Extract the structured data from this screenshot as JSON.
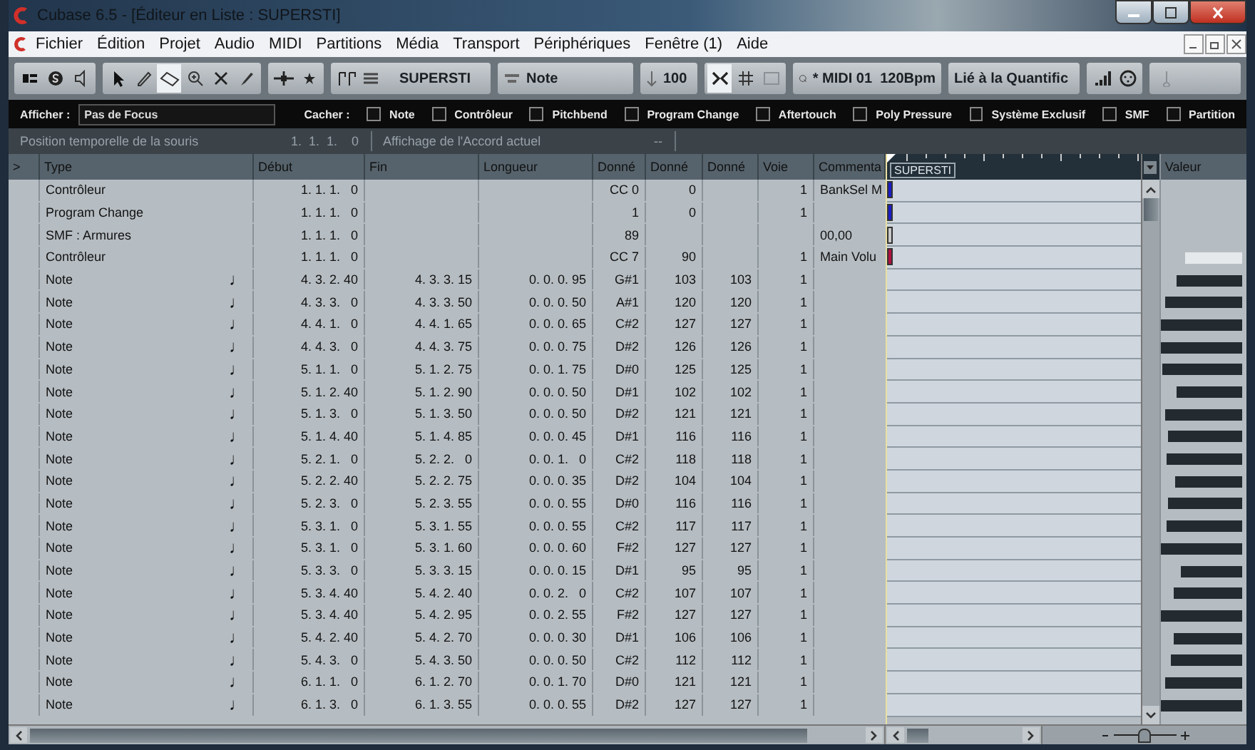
{
  "window": {
    "title": "Cubase 6.5 - [Éditeur en Liste : SUPERSTI]"
  },
  "menu": [
    "Fichier",
    "Édition",
    "Projet",
    "Audio",
    "MIDI",
    "Partitions",
    "Média",
    "Transport",
    "Périphériques",
    "Fenêtre (1)",
    "Aide"
  ],
  "toolbar": {
    "tools": [
      {
        "kind": "pointer",
        "selected": false
      },
      {
        "kind": "pencil",
        "selected": false
      },
      {
        "kind": "eraser",
        "selected": true
      },
      {
        "kind": "zoom",
        "selected": false
      },
      {
        "kind": "mute",
        "selected": false
      },
      {
        "kind": "brush",
        "selected": false
      }
    ],
    "track": "SUPERSTI",
    "insert_type": "Note",
    "velocity": "100",
    "quantize": "* MIDI 01  120Bpm",
    "length": "Lié à la Quantific"
  },
  "filter": {
    "show_label": "Afficher :",
    "show_value": "Pas de Focus",
    "hide_label": "Cacher :",
    "hide_options": [
      {
        "label": "Note",
        "checked": false
      },
      {
        "label": "Contrôleur",
        "checked": false
      },
      {
        "label": "Pitchbend",
        "checked": false
      },
      {
        "label": "Program Change",
        "checked": false
      },
      {
        "label": "Aftertouch",
        "checked": false
      },
      {
        "label": "Poly Pressure",
        "checked": false
      },
      {
        "label": "Système Exclusif",
        "checked": false
      },
      {
        "label": "SMF",
        "checked": false
      },
      {
        "label": "Partition",
        "checked": false
      }
    ]
  },
  "info": {
    "mouse_label": "Position temporelle de la souris",
    "mouse_value": "1.  1.  1.    0",
    "chord_label": "Affichage de l'Accord actuel",
    "chord_value": "--"
  },
  "table": {
    "columns": [
      ">",
      "Type",
      "Début",
      "Fin",
      "Longueur",
      "Donné",
      "Donné",
      "Donné",
      "Voie",
      "Commenta"
    ],
    "lane_label": "SUPERSTI",
    "value_column": "Valeur",
    "zoom": {
      "level": 0.5
    },
    "rows": [
      {
        "kind": "controller",
        "type": "Contrôleur",
        "start": "1. 1. 1.   0",
        "data1": "CC 0",
        "data2": "0",
        "channel": "1",
        "comment": "BankSel M",
        "color": "#1c1cc8"
      },
      {
        "kind": "program",
        "type": "Program Change",
        "start": "1. 1. 1.   0",
        "data1": "1",
        "data2": "0",
        "channel": "1",
        "color": "#1c1cc8"
      },
      {
        "kind": "meta",
        "type": "SMF : Armures",
        "start": "1. 1. 1.   0",
        "data1": "89",
        "comment": "00,00",
        "color": "#c8c8c8"
      },
      {
        "kind": "controller",
        "type": "Contrôleur",
        "start": "1. 1. 1.   0",
        "data1": "CC 7",
        "data2": "90",
        "channel": "1",
        "comment": "Main Volu",
        "color": "#b01040"
      },
      {
        "kind": "note",
        "type": "Note",
        "symbol": "♩",
        "start": "4. 3. 2. 40",
        "end": "4. 3. 3. 15",
        "length": "0. 0. 0. 95",
        "data1": "G#1",
        "data2": "103",
        "data3": "103",
        "channel": "1"
      },
      {
        "kind": "note",
        "type": "Note",
        "symbol": "♩",
        "start": "4. 3. 3.   0",
        "end": "4. 3. 3. 50",
        "length": "0. 0. 0. 50",
        "data1": "A#1",
        "data2": "120",
        "data3": "120",
        "channel": "1"
      },
      {
        "kind": "note",
        "type": "Note",
        "symbol": "♩",
        "start": "4. 4. 1.   0",
        "end": "4. 4. 1. 65",
        "length": "0. 0. 0. 65",
        "data1": "C#2",
        "data2": "127",
        "data3": "127",
        "channel": "1"
      },
      {
        "kind": "note",
        "type": "Note",
        "symbol": "♩",
        "start": "4. 4. 3.   0",
        "end": "4. 4. 3. 75",
        "length": "0. 0. 0. 75",
        "data1": "D#2",
        "data2": "126",
        "data3": "126",
        "channel": "1"
      },
      {
        "kind": "note",
        "type": "Note",
        "symbol": "♩",
        "start": "5. 1. 1.   0",
        "end": "5. 1. 2. 75",
        "length": "0. 0. 1. 75",
        "data1": "D#0",
        "data2": "125",
        "data3": "125",
        "channel": "1"
      },
      {
        "kind": "note",
        "type": "Note",
        "symbol": "♩",
        "start": "5. 1. 2. 40",
        "end": "5. 1. 2. 90",
        "length": "0. 0. 0. 50",
        "data1": "D#1",
        "data2": "102",
        "data3": "102",
        "channel": "1"
      },
      {
        "kind": "note",
        "type": "Note",
        "symbol": "♩",
        "start": "5. 1. 3.   0",
        "end": "5. 1. 3. 50",
        "length": "0. 0. 0. 50",
        "data1": "D#2",
        "data2": "121",
        "data3": "121",
        "channel": "1"
      },
      {
        "kind": "note",
        "type": "Note",
        "symbol": "♩",
        "start": "5. 1. 4. 40",
        "end": "5. 1. 4. 85",
        "length": "0. 0. 0. 45",
        "data1": "D#1",
        "data2": "116",
        "data3": "116",
        "channel": "1"
      },
      {
        "kind": "note",
        "type": "Note",
        "symbol": "♩",
        "start": "5. 2. 1.   0",
        "end": "5. 2. 2.   0",
        "length": "0. 0. 1.   0",
        "data1": "C#2",
        "data2": "118",
        "data3": "118",
        "channel": "1"
      },
      {
        "kind": "note",
        "type": "Note",
        "symbol": "♩",
        "start": "5. 2. 2. 40",
        "end": "5. 2. 2. 75",
        "length": "0. 0. 0. 35",
        "data1": "D#2",
        "data2": "104",
        "data3": "104",
        "channel": "1"
      },
      {
        "kind": "note",
        "type": "Note",
        "symbol": "♩",
        "start": "5. 2. 3.   0",
        "end": "5. 2. 3. 55",
        "length": "0. 0. 0. 55",
        "data1": "D#0",
        "data2": "116",
        "data3": "116",
        "channel": "1"
      },
      {
        "kind": "note",
        "type": "Note",
        "symbol": "♩",
        "start": "5. 3. 1.   0",
        "end": "5. 3. 1. 55",
        "length": "0. 0. 0. 55",
        "data1": "C#2",
        "data2": "117",
        "data3": "117",
        "channel": "1"
      },
      {
        "kind": "note",
        "type": "Note",
        "symbol": "♩",
        "start": "5. 3. 1.   0",
        "end": "5. 3. 1. 60",
        "length": "0. 0. 0. 60",
        "data1": "F#2",
        "data2": "127",
        "data3": "127",
        "channel": "1"
      },
      {
        "kind": "note",
        "type": "Note",
        "symbol": "♩",
        "start": "5. 3. 3.   0",
        "end": "5. 3. 3. 15",
        "length": "0. 0. 0. 15",
        "data1": "D#1",
        "data2": "95",
        "data3": "95",
        "channel": "1"
      },
      {
        "kind": "note",
        "type": "Note",
        "symbol": "♩",
        "start": "5. 3. 4. 40",
        "end": "5. 4. 2. 40",
        "length": "0. 0. 2.   0",
        "data1": "C#2",
        "data2": "107",
        "data3": "107",
        "channel": "1"
      },
      {
        "kind": "note",
        "type": "Note",
        "symbol": "♩",
        "start": "5. 3. 4. 40",
        "end": "5. 4. 2. 95",
        "length": "0. 0. 2. 55",
        "data1": "F#2",
        "data2": "127",
        "data3": "127",
        "channel": "1"
      },
      {
        "kind": "note",
        "type": "Note",
        "symbol": "♩",
        "start": "5. 4. 2. 40",
        "end": "5. 4. 2. 70",
        "length": "0. 0. 0. 30",
        "data1": "D#1",
        "data2": "106",
        "data3": "106",
        "channel": "1"
      },
      {
        "kind": "note",
        "type": "Note",
        "symbol": "♩",
        "start": "5. 4. 3.   0",
        "end": "5. 4. 3. 50",
        "length": "0. 0. 0. 50",
        "data1": "C#2",
        "data2": "112",
        "data3": "112",
        "channel": "1"
      },
      {
        "kind": "note",
        "type": "Note",
        "symbol": "♩",
        "start": "6. 1. 1.   0",
        "end": "6. 1. 2. 70",
        "length": "0. 0. 1. 70",
        "data1": "D#0",
        "data2": "121",
        "data3": "121",
        "channel": "1"
      },
      {
        "kind": "note",
        "type": "Note",
        "symbol": "♩",
        "start": "6. 1. 3.   0",
        "end": "6. 1. 3. 55",
        "length": "0. 0. 0. 55",
        "data1": "D#2",
        "data2": "127",
        "data3": "127",
        "channel": "1"
      }
    ]
  }
}
